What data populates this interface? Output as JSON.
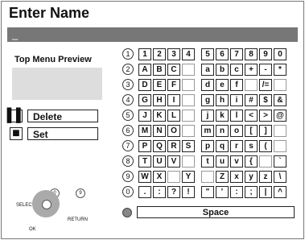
{
  "title": "Enter Name",
  "name_field": {
    "value": "_"
  },
  "left": {
    "preview_label": "Top Menu Preview",
    "delete_label": "Delete",
    "set_label": "Set",
    "remote": {
      "select": "SELECT",
      "ok": "OK",
      "return": "RETURN",
      "dial_left": "0",
      "dial_right": "9"
    }
  },
  "keyboard": {
    "rows": [
      {
        "num": "1",
        "left": [
          "1",
          "2",
          "3",
          "4"
        ],
        "right": [
          "5",
          "6",
          "7",
          "8",
          "9",
          "0"
        ]
      },
      {
        "num": "2",
        "left": [
          "A",
          "B",
          "C",
          ""
        ],
        "right": [
          "a",
          "b",
          "c",
          "+",
          "-",
          "*"
        ]
      },
      {
        "num": "3",
        "left": [
          "D",
          "E",
          "F",
          ""
        ],
        "right": [
          "d",
          "e",
          "f",
          "",
          "/=",
          ""
        ]
      },
      {
        "num": "4",
        "left": [
          "G",
          "H",
          "I",
          ""
        ],
        "right": [
          "g",
          "h",
          "i",
          "#",
          "$",
          "&"
        ]
      },
      {
        "num": "5",
        "left": [
          "J",
          "K",
          "L",
          ""
        ],
        "right": [
          "j",
          "k",
          "l",
          "<",
          ">",
          "@"
        ]
      },
      {
        "num": "6",
        "left": [
          "M",
          "N",
          "O",
          ""
        ],
        "right": [
          "m",
          "n",
          "o",
          "[",
          "]",
          ""
        ]
      },
      {
        "num": "7",
        "left": [
          "P",
          "Q",
          "R",
          "S"
        ],
        "right": [
          "p",
          "q",
          "r",
          "s",
          "(",
          ""
        ]
      },
      {
        "num": "8",
        "left": [
          "T",
          "U",
          "V",
          ""
        ],
        "right": [
          "t",
          "u",
          "v",
          "{",
          "",
          "`"
        ]
      },
      {
        "num": "9",
        "left": [
          "W",
          "X",
          "",
          "Y"
        ],
        "right": [
          "",
          "Z",
          "x",
          "y",
          "z",
          "\\"
        ]
      },
      {
        "num": "0",
        "left": [
          ".",
          ":",
          "?",
          "!"
        ],
        "right": [
          "\"",
          "'",
          ":",
          ";",
          "|",
          "^"
        ]
      }
    ],
    "space_label": "Space"
  }
}
